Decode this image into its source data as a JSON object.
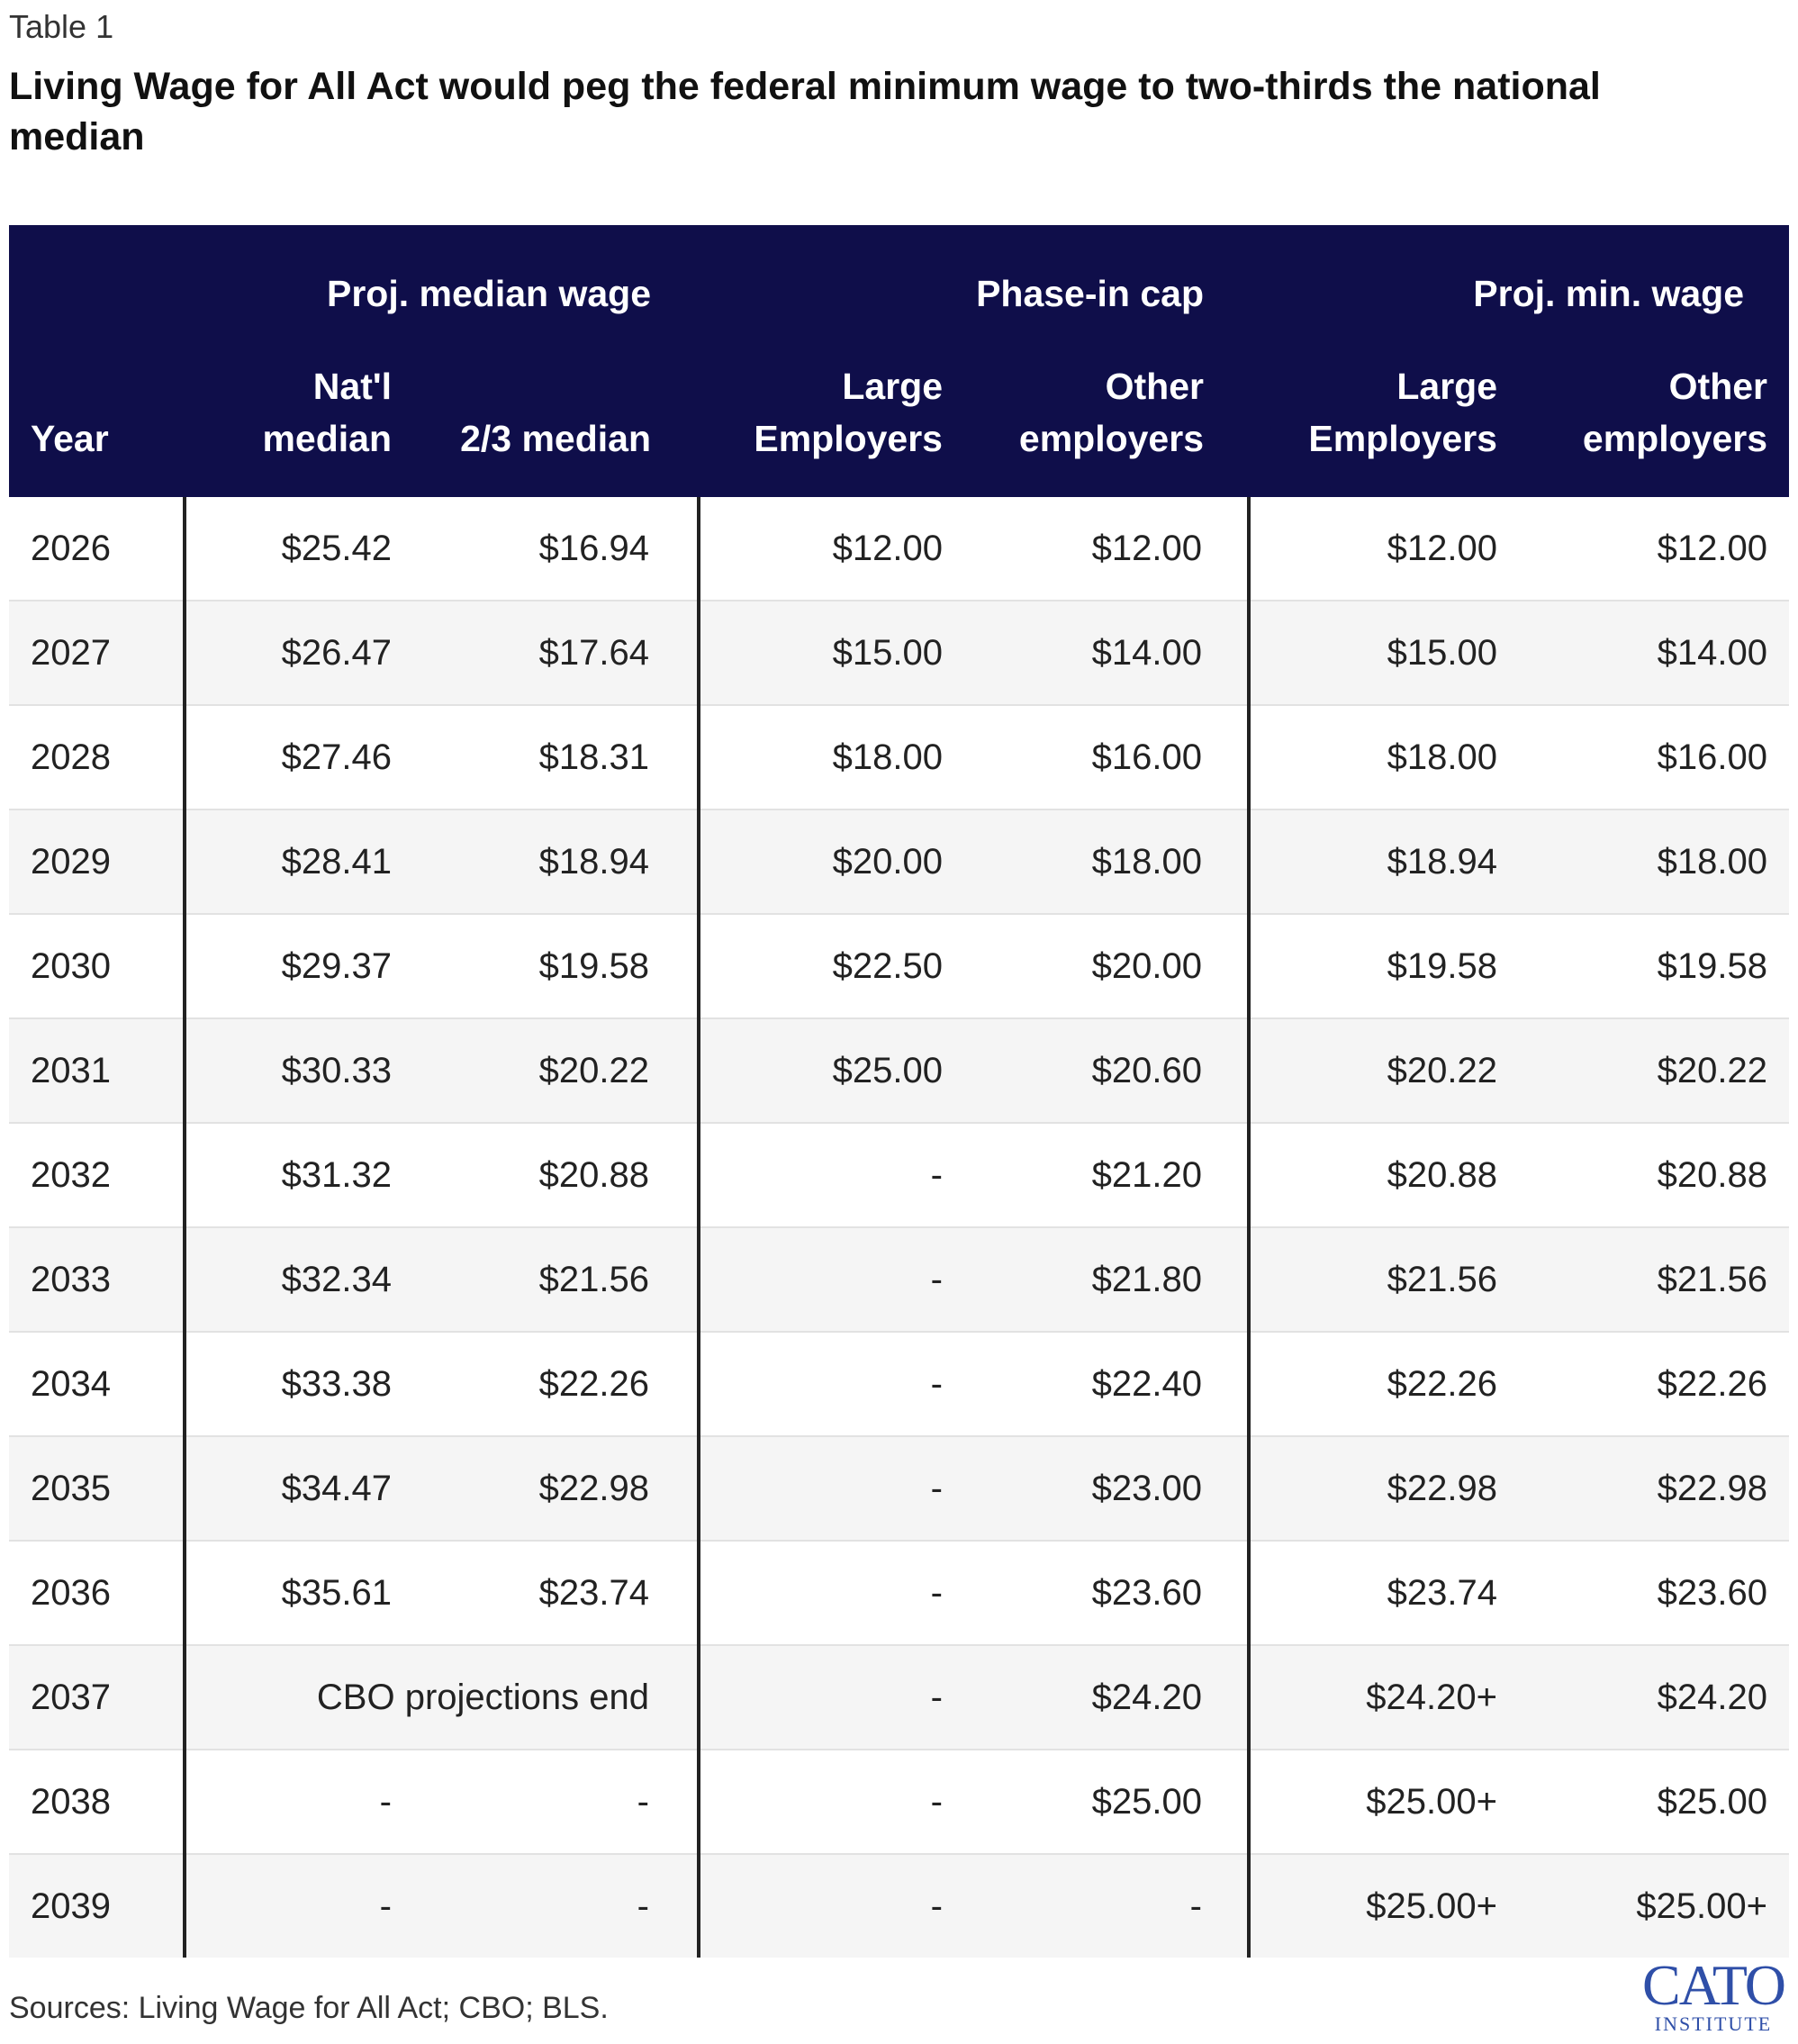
{
  "label": "Table 1",
  "title": "Living Wage for All Act would peg the federal minimum wage to two-thirds the national median",
  "header": {
    "groups": [
      "Proj. median wage",
      "Phase-in cap",
      "Proj. min. wage"
    ],
    "year": "Year",
    "cols": [
      "Nat'l median",
      "2/3 median",
      "Large Employers",
      "Other employers",
      "Large Employers",
      "Other employers"
    ]
  },
  "rows": [
    {
      "year": "2026",
      "cells": [
        "$25.42",
        "$16.94",
        "$12.00",
        "$12.00",
        "$12.00",
        "$12.00"
      ]
    },
    {
      "year": "2027",
      "cells": [
        "$26.47",
        "$17.64",
        "$15.00",
        "$14.00",
        "$15.00",
        "$14.00"
      ]
    },
    {
      "year": "2028",
      "cells": [
        "$27.46",
        "$18.31",
        "$18.00",
        "$16.00",
        "$18.00",
        "$16.00"
      ]
    },
    {
      "year": "2029",
      "cells": [
        "$28.41",
        "$18.94",
        "$20.00",
        "$18.00",
        "$18.94",
        "$18.00"
      ]
    },
    {
      "year": "2030",
      "cells": [
        "$29.37",
        "$19.58",
        "$22.50",
        "$20.00",
        "$19.58",
        "$19.58"
      ]
    },
    {
      "year": "2031",
      "cells": [
        "$30.33",
        "$20.22",
        "$25.00",
        "$20.60",
        "$20.22",
        "$20.22"
      ]
    },
    {
      "year": "2032",
      "cells": [
        "$31.32",
        "$20.88",
        "-",
        "$21.20",
        "$20.88",
        "$20.88"
      ]
    },
    {
      "year": "2033",
      "cells": [
        "$32.34",
        "$21.56",
        "-",
        "$21.80",
        "$21.56",
        "$21.56"
      ]
    },
    {
      "year": "2034",
      "cells": [
        "$33.38",
        "$22.26",
        "-",
        "$22.40",
        "$22.26",
        "$22.26"
      ]
    },
    {
      "year": "2035",
      "cells": [
        "$34.47",
        "$22.98",
        "-",
        "$23.00",
        "$22.98",
        "$22.98"
      ]
    },
    {
      "year": "2036",
      "cells": [
        "$35.61",
        "$23.74",
        "-",
        "$23.60",
        "$23.74",
        "$23.60"
      ]
    },
    {
      "year": "2037",
      "merged": "CBO projections end",
      "cells": [
        "-",
        "$24.20",
        "$24.20+",
        "$24.20"
      ]
    },
    {
      "year": "2038",
      "cells": [
        "-",
        "-",
        "-",
        "$25.00",
        "$25.00+",
        "$25.00"
      ]
    },
    {
      "year": "2039",
      "cells": [
        "-",
        "-",
        "-",
        "-",
        "$25.00+",
        "$25.00+"
      ]
    }
  ],
  "source": "Sources: Living Wage for All Act; CBO; BLS.",
  "logo": {
    "name": "CATO",
    "sub": "INSTITUTE"
  },
  "colors": {
    "header_bg": "#0f0e4a",
    "logo": "#2f4fa8"
  }
}
